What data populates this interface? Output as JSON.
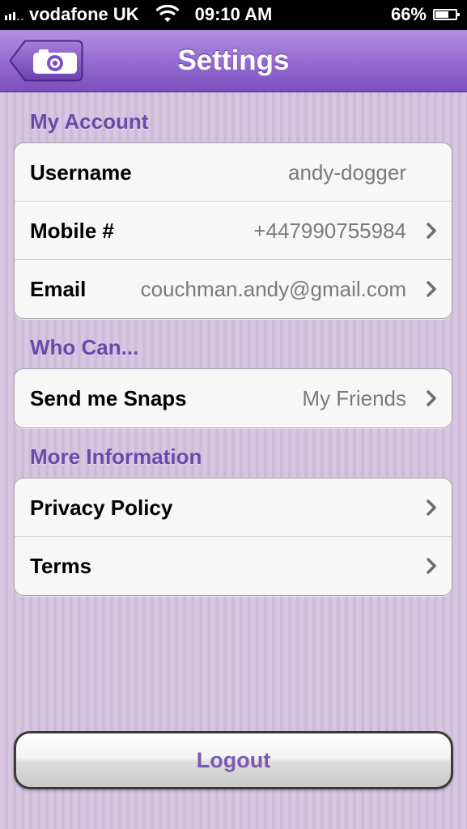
{
  "status_bar": {
    "carrier": "vodafone UK",
    "time": "09:10 AM",
    "battery_percent": "66%",
    "battery_level": 0.66,
    "icons": [
      "signal-icon",
      "wifi-icon",
      "battery-icon"
    ]
  },
  "nav": {
    "title": "Settings",
    "back_icon": "camera-icon"
  },
  "sections": {
    "my_account": {
      "header": "My Account",
      "rows": [
        {
          "label": "Username",
          "value": "andy-dogger",
          "chevron": false
        },
        {
          "label": "Mobile #",
          "value": "+447990755984",
          "chevron": true
        },
        {
          "label": "Email",
          "value": "couchman.andy@gmail.com",
          "chevron": true
        }
      ]
    },
    "who_can": {
      "header": "Who Can...",
      "rows": [
        {
          "label": "Send me Snaps",
          "value": "My Friends",
          "chevron": true
        }
      ]
    },
    "more_info": {
      "header": "More Information",
      "rows": [
        {
          "label": "Privacy Policy",
          "chevron": true
        },
        {
          "label": "Terms",
          "chevron": true
        }
      ]
    }
  },
  "logout_label": "Logout",
  "colors": {
    "accent": "#6c48a9",
    "nav_top": "#b58fe0",
    "nav_bottom": "#7c4fbf",
    "background": "#d4c3de"
  }
}
